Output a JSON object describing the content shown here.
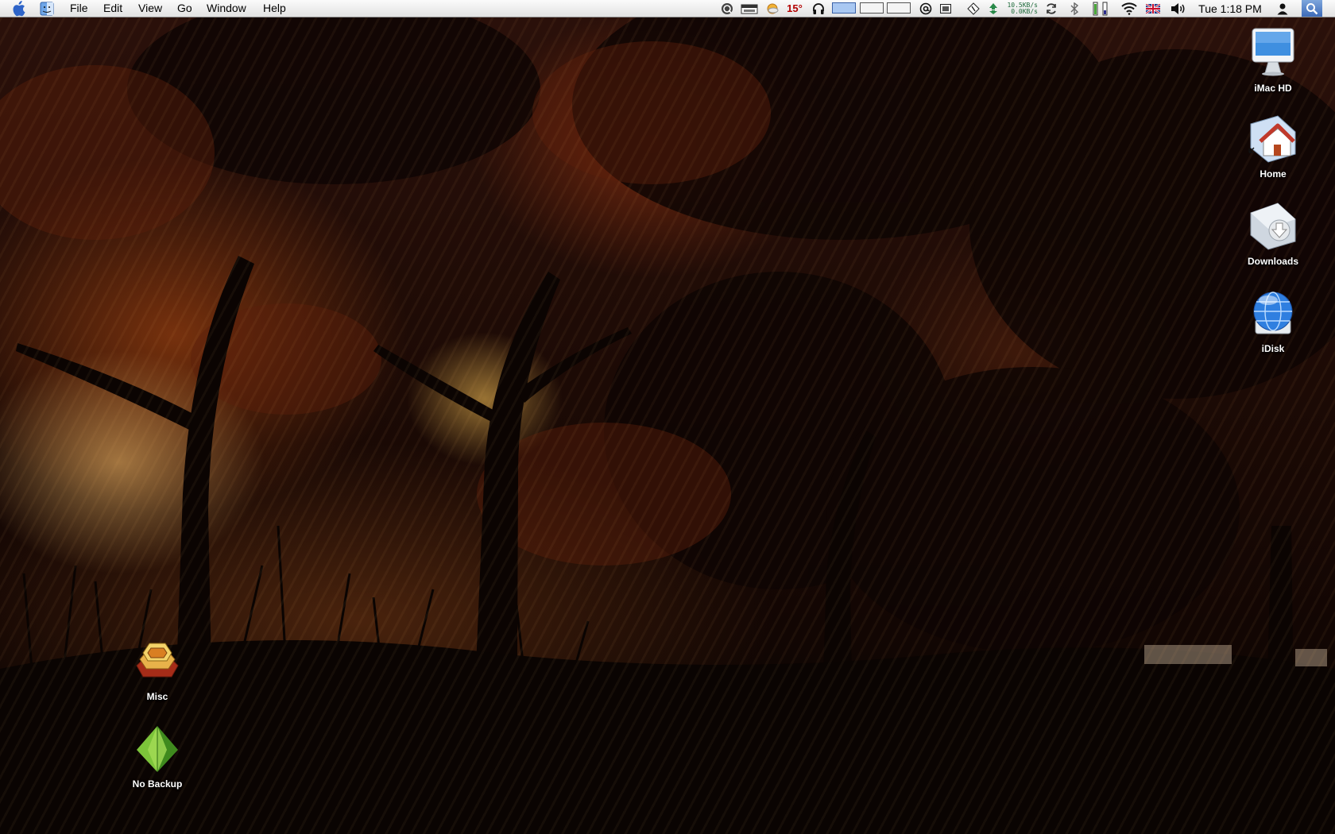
{
  "menubar": {
    "menus": [
      "File",
      "Edit",
      "View",
      "Go",
      "Window",
      "Help"
    ],
    "status": {
      "weather_temp": "15°",
      "net_up": "10.5KB/s",
      "net_down": "0.0KB/s",
      "input_flag": "UK flag",
      "clock": "Tue 1:18 PM",
      "spaces_active_index": 0
    },
    "icons": [
      "apple-icon",
      "finder-icon",
      "quicksilver-icon",
      "calendar-icon",
      "weather-icon",
      "headphones-icon",
      "spaces-icon",
      "mail-at-icon",
      "screen-capture-icon",
      "script-icon",
      "network-monitor-icon",
      "sync-icon",
      "bluetooth-icon",
      "battery-meter-icon",
      "wifi-icon",
      "flag-icon",
      "volume-icon",
      "user-icon",
      "spotlight-icon"
    ]
  },
  "desktop": {
    "right_icons": [
      {
        "label": "iMac HD",
        "icon": "hard-drive-icon"
      },
      {
        "label": "Home",
        "icon": "home-folder-icon"
      },
      {
        "label": "Downloads",
        "icon": "downloads-folder-icon"
      },
      {
        "label": "iDisk",
        "icon": "idisk-icon"
      }
    ],
    "left_icons": [
      {
        "label": "Misc",
        "icon": "stacked-layers-icon"
      },
      {
        "label": "No Backup",
        "icon": "green-pyramid-icon"
      }
    ]
  },
  "colors": {
    "menubar_bg": "#ececec",
    "weather_temp": "#b30000",
    "wallpaper_glow": "#ffc46e",
    "wallpaper_dark": "#120603"
  }
}
